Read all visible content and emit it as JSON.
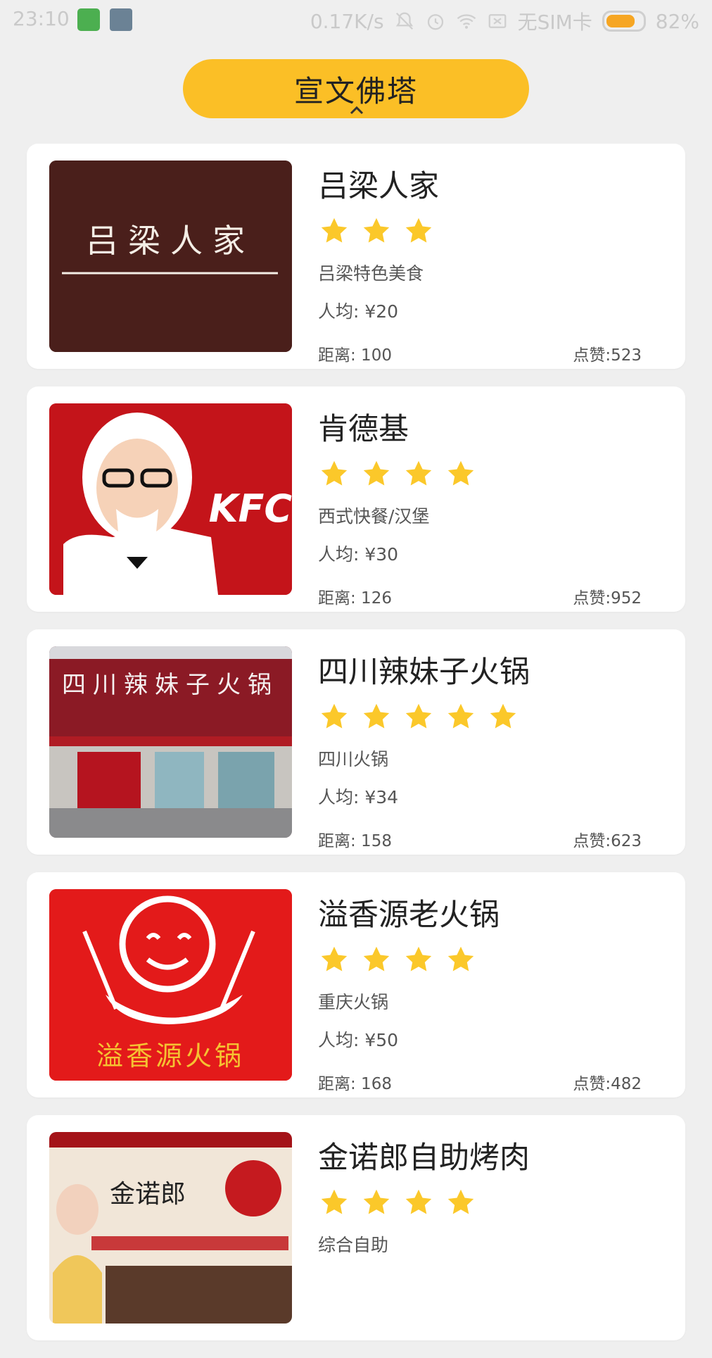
{
  "status_bar": {
    "time": "23:10",
    "speed": "0.17K/s",
    "carrier": "无SIM卡",
    "battery": "82%",
    "battery_level": 0.82,
    "icons": [
      "android-notification-icon",
      "note-notification-icon",
      "mute-bell-icon",
      "alarm-icon",
      "wifi-icon",
      "no-sim-icon",
      "battery-icon"
    ]
  },
  "header": {
    "title": "宣文佛塔"
  },
  "colors": {
    "accent": "#fbbf26",
    "star": "#fbc82a"
  },
  "restaurants": [
    {
      "name": "吕梁人家",
      "rating": 3,
      "category": "吕梁特色美食",
      "avg_price": "人均: ¥20",
      "distance": "距离: 100",
      "likes": "点赞:523",
      "logo_text": "吕梁人家"
    },
    {
      "name": "肯德基",
      "rating": 4,
      "category": "西式快餐/汉堡",
      "avg_price": "人均: ¥30",
      "distance": "距离: 126",
      "likes": "点赞:952",
      "logo_text": "KFC"
    },
    {
      "name": "四川辣妹子火锅",
      "rating": 5,
      "category": "四川火锅",
      "avg_price": "人均: ¥34",
      "distance": "距离: 158",
      "likes": "点赞:623",
      "logo_text": "四川辣妹子火锅"
    },
    {
      "name": "溢香源老火锅",
      "rating": 4,
      "category": "重庆火锅",
      "avg_price": "人均: ¥50",
      "distance": "距离: 168",
      "likes": "点赞:482",
      "logo_text": "溢香源火锅"
    },
    {
      "name": "金诺郎自助烤肉",
      "rating": 4,
      "category": "综合自助",
      "avg_price": "",
      "distance": "",
      "likes": "",
      "logo_text": "金诺郎"
    }
  ]
}
